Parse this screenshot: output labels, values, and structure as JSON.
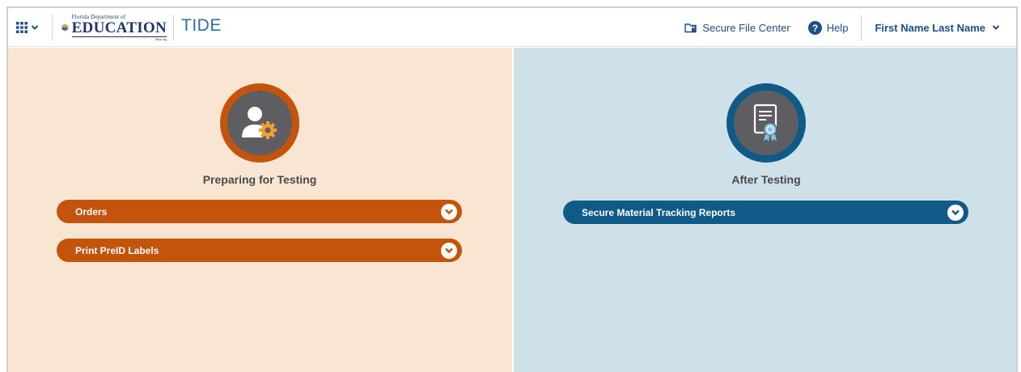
{
  "header": {
    "logo": {
      "line1": "Florida Department of",
      "line2": "EDUCATION",
      "line3": "fldoe.org"
    },
    "app_name": "TIDE",
    "secure_file_center": "Secure File Center",
    "help": "Help",
    "user_name": "First Name Last Name"
  },
  "colors": {
    "prep_bg": "#f9e6d2",
    "after_bg": "#cfe1e8",
    "prep_accent": "#c4530c",
    "after_accent": "#0f5a86"
  },
  "categories": [
    {
      "title": "Preparing for Testing",
      "icon": "user-gear-icon",
      "items": [
        {
          "label": "Orders"
        },
        {
          "label": "Print PreID Labels"
        }
      ]
    },
    {
      "title": "After Testing",
      "icon": "certificate-icon",
      "items": [
        {
          "label": "Secure Material Tracking Reports"
        }
      ]
    }
  ]
}
